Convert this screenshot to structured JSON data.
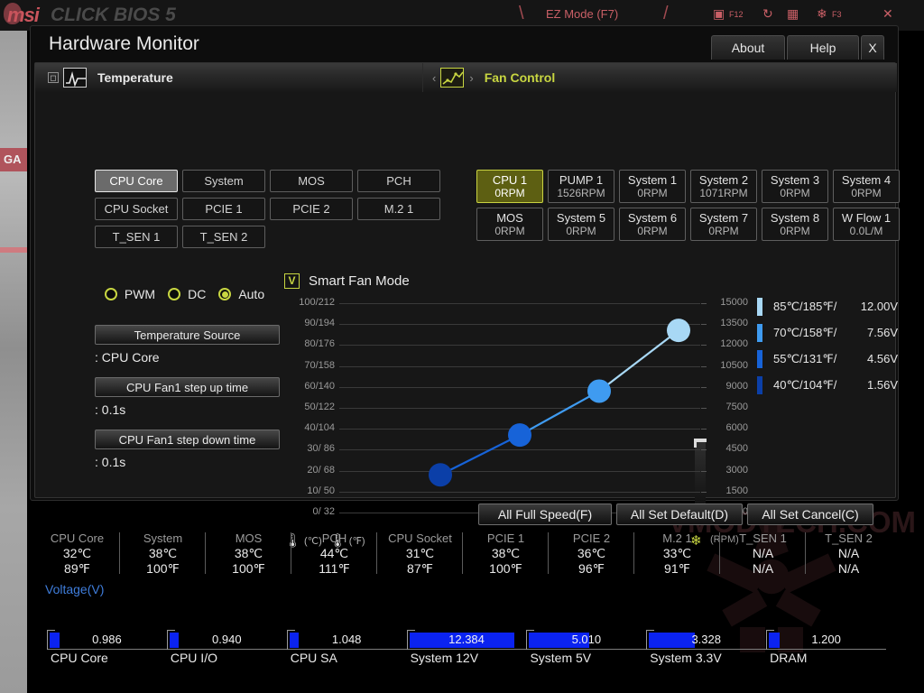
{
  "background": {
    "brand": "msi",
    "product": "CLICK BIOS 5",
    "ez_mode": "EZ Mode (F7)",
    "side_tag": "GA",
    "icons": [
      "screenshot-f12-icon",
      "refresh-icon",
      "monitor-icon",
      "favorites-icon",
      "close-icon"
    ],
    "screenshot_hint": "F12",
    "fav_hint": "F3",
    "watermark": "VMODTECH.COM"
  },
  "window": {
    "title": "Hardware Monitor",
    "buttons": {
      "about": "About",
      "help": "Help",
      "close": "X"
    }
  },
  "temperature_panel": {
    "header": "Temperature",
    "sources": [
      {
        "label": "CPU Core",
        "selected": true
      },
      {
        "label": "System",
        "selected": false
      },
      {
        "label": "MOS",
        "selected": false
      },
      {
        "label": "PCH",
        "selected": false
      },
      {
        "label": "CPU Socket",
        "selected": false
      },
      {
        "label": "PCIE 1",
        "selected": false
      },
      {
        "label": "PCIE 2",
        "selected": false
      },
      {
        "label": "M.2 1",
        "selected": false
      },
      {
        "label": "T_SEN 1",
        "selected": false
      },
      {
        "label": "T_SEN 2",
        "selected": false
      }
    ]
  },
  "fan_panel": {
    "header": "Fan Control",
    "fans": [
      {
        "name": "CPU 1",
        "value": "0RPM",
        "selected": true
      },
      {
        "name": "PUMP 1",
        "value": "1526RPM",
        "selected": false
      },
      {
        "name": "System 1",
        "value": "0RPM",
        "selected": false
      },
      {
        "name": "System 2",
        "value": "1071RPM",
        "selected": false
      },
      {
        "name": "System 3",
        "value": "0RPM",
        "selected": false
      },
      {
        "name": "System 4",
        "value": "0RPM",
        "selected": false
      },
      {
        "name": "MOS",
        "value": "0RPM",
        "selected": false
      },
      {
        "name": "System 5",
        "value": "0RPM",
        "selected": false
      },
      {
        "name": "System 6",
        "value": "0RPM",
        "selected": false
      },
      {
        "name": "System 7",
        "value": "0RPM",
        "selected": false
      },
      {
        "name": "System 8",
        "value": "0RPM",
        "selected": false
      },
      {
        "name": "W Flow 1",
        "value": "0.0L/M",
        "selected": false
      }
    ]
  },
  "controls": {
    "modes": [
      {
        "label": "PWM",
        "selected": false
      },
      {
        "label": "DC",
        "selected": false
      },
      {
        "label": "Auto",
        "selected": true
      }
    ],
    "temp_source_label": "Temperature Source",
    "temp_source_value": ": CPU Core",
    "step_up_label": "CPU Fan1 step up time",
    "step_up_value": ": 0.1s",
    "step_down_label": "CPU Fan1 step down time",
    "step_down_value": ": 0.1s"
  },
  "smart_fan": {
    "checkbox": "V",
    "label": "Smart Fan Mode"
  },
  "chart_data": {
    "type": "line",
    "title": "Smart Fan Mode",
    "xlabel": "",
    "ylabel": "Temperature (°C/°F)",
    "y2label": "(RPM)",
    "ylim": [
      0,
      100
    ],
    "y2lim": [
      0,
      15000
    ],
    "grid": true,
    "legend_position": "right",
    "y_ticks": [
      "100/212",
      "90/194",
      "80/176",
      "70/158",
      "60/140",
      "50/122",
      "40/104",
      "30/ 86",
      "20/ 68",
      "10/ 50",
      "0/ 32"
    ],
    "y_tick_values": [
      100,
      90,
      80,
      70,
      60,
      50,
      40,
      30,
      20,
      10,
      0
    ],
    "y2_ticks": [
      "15000",
      "13500",
      "12000",
      "10500",
      "9000",
      "7500",
      "6000",
      "4500",
      "3000",
      "1500",
      "0"
    ],
    "y2_tick_values": [
      15000,
      13500,
      12000,
      10500,
      9000,
      7500,
      6000,
      4500,
      3000,
      1500,
      0
    ],
    "footer_units": [
      "(℃)",
      "(℉)"
    ],
    "points": [
      {
        "index": 1,
        "temp_c": 40,
        "temp_f": 104,
        "volt": "1.56V",
        "x_pct": 28,
        "y_pct": 18,
        "color": "#0b3fa8"
      },
      {
        "index": 2,
        "temp_c": 55,
        "temp_f": 131,
        "volt": "4.56V",
        "x_pct": 50,
        "y_pct": 37,
        "color": "#1763d8"
      },
      {
        "index": 3,
        "temp_c": 70,
        "temp_f": 158,
        "volt": "7.56V",
        "x_pct": 72,
        "y_pct": 58,
        "color": "#3f9bf0"
      },
      {
        "index": 4,
        "temp_c": 85,
        "temp_f": 185,
        "volt": "12.00V",
        "x_pct": 94,
        "y_pct": 87,
        "color": "#a8d8f5"
      }
    ]
  },
  "curve_legend": [
    {
      "temp": "85℃/185℉/",
      "volt": "12.00V",
      "color": "#a8d8f5"
    },
    {
      "temp": "70℃/158℉/",
      "volt": "7.56V",
      "color": "#3f9bf0"
    },
    {
      "temp": "55℃/131℉/",
      "volt": "4.56V",
      "color": "#1763d8"
    },
    {
      "temp": "40℃/104℉/",
      "volt": "1.56V",
      "color": "#0b3fa8"
    }
  ],
  "actions": [
    {
      "label": "All Full Speed(F)"
    },
    {
      "label": "All Set Default(D)"
    },
    {
      "label": "All Set Cancel(C)"
    }
  ],
  "temperatures": [
    {
      "name": "CPU Core",
      "c": "32℃",
      "f": "89℉"
    },
    {
      "name": "System",
      "c": "38℃",
      "f": "100℉"
    },
    {
      "name": "MOS",
      "c": "38℃",
      "f": "100℉"
    },
    {
      "name": "PCH",
      "c": "44℃",
      "f": "111℉"
    },
    {
      "name": "CPU Socket",
      "c": "31℃",
      "f": "87℉"
    },
    {
      "name": "PCIE 1",
      "c": "38℃",
      "f": "100℉"
    },
    {
      "name": "PCIE 2",
      "c": "36℃",
      "f": "96℉"
    },
    {
      "name": "M.2 1",
      "c": "33℃",
      "f": "91℉"
    },
    {
      "name": "T_SEN 1",
      "c": "N/A",
      "f": "N/A"
    },
    {
      "name": "T_SEN 2",
      "c": "N/A",
      "f": "N/A"
    }
  ],
  "voltage": {
    "title": "Voltage(V)",
    "items": [
      {
        "name": "CPU Core",
        "value": "0.986",
        "fill_pct": 8
      },
      {
        "name": "CPU I/O",
        "value": "0.940",
        "fill_pct": 8
      },
      {
        "name": "CPU SA",
        "value": "1.048",
        "fill_pct": 8
      },
      {
        "name": "System 12V",
        "value": "12.384",
        "fill_pct": 88
      },
      {
        "name": "System 5V",
        "value": "5.010",
        "fill_pct": 50
      },
      {
        "name": "System 3.3V",
        "value": "3.328",
        "fill_pct": 38
      },
      {
        "name": "DRAM",
        "value": "1.200",
        "fill_pct": 9
      }
    ]
  }
}
